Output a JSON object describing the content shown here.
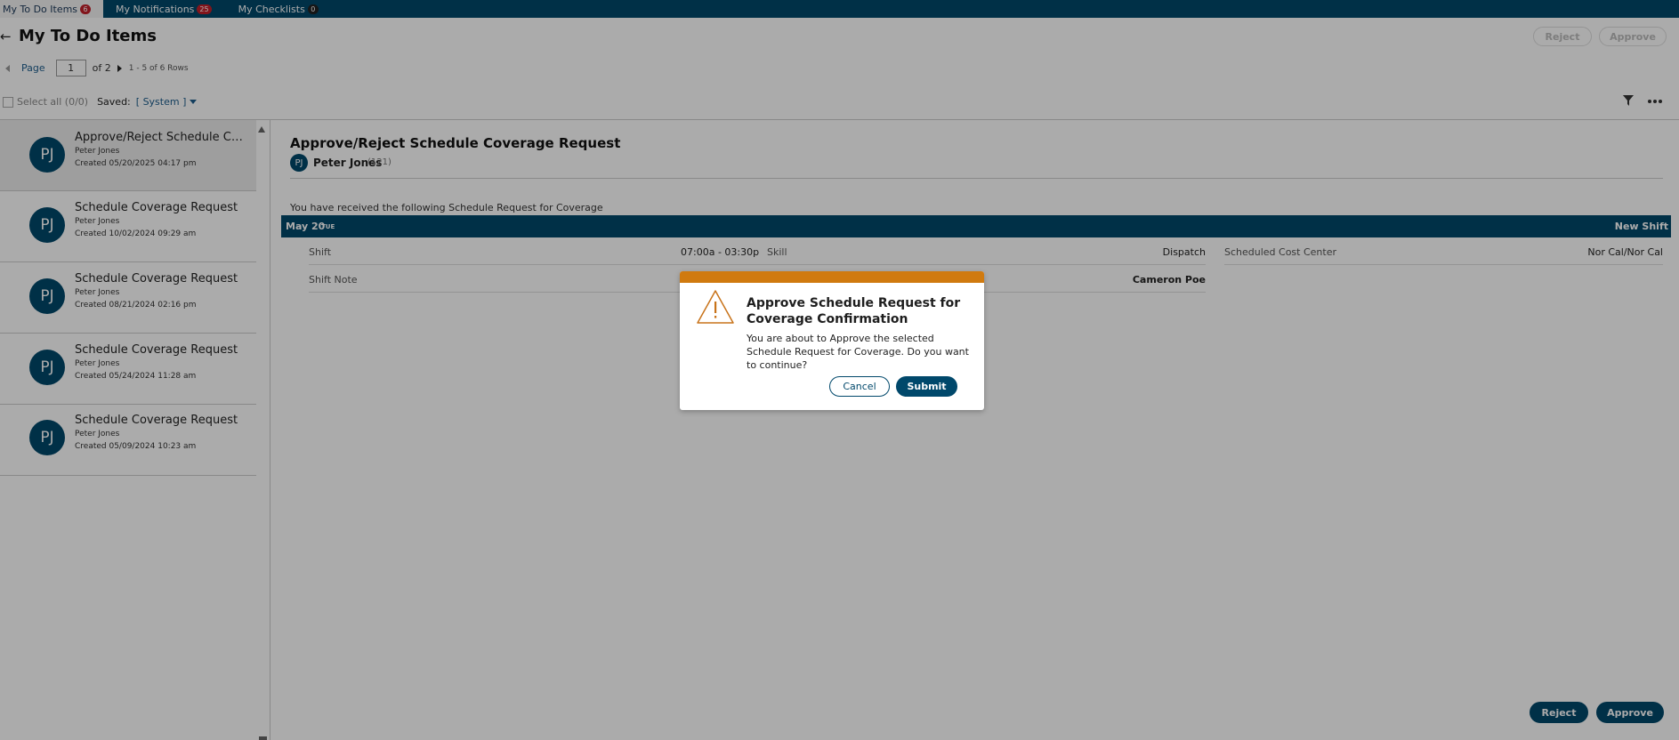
{
  "tabs": [
    {
      "label": "My To Do Items",
      "count": "6",
      "badge_color": "#c2202a"
    },
    {
      "label": "My Notifications",
      "count": "25",
      "badge_color": "#c2202a"
    },
    {
      "label": "My Checklists",
      "count": "0",
      "badge_color": "#222222"
    }
  ],
  "header": {
    "back_icon": "arrow-left-icon",
    "title": "My To Do Items",
    "reject_label": "Reject",
    "approve_label": "Approve"
  },
  "pager": {
    "page_label": "Page",
    "page_value": "1",
    "of_label": "of 2",
    "rows_label": "1 - 5 of 6 Rows"
  },
  "toolbar": {
    "select_all_label": "Select all (0/0)",
    "saved_label": "Saved:",
    "saved_value": "[ System ]",
    "filter_icon": "filter-icon",
    "more_icon": "more-icon"
  },
  "list": [
    {
      "initials": "PJ",
      "title": "Approve/Reject Schedule Cover...",
      "person": "Peter Jones",
      "created": "Created 05/20/2025 04:17 pm"
    },
    {
      "initials": "PJ",
      "title": "Schedule Coverage Request",
      "person": "Peter Jones",
      "created": "Created 10/02/2024 09:29 am"
    },
    {
      "initials": "PJ",
      "title": "Schedule Coverage Request",
      "person": "Peter Jones",
      "created": "Created 08/21/2024 02:16 pm"
    },
    {
      "initials": "PJ",
      "title": "Schedule Coverage Request",
      "person": "Peter Jones",
      "created": "Created 05/24/2024 11:28 am"
    },
    {
      "initials": "PJ",
      "title": "Schedule Coverage Request",
      "person": "Peter Jones",
      "created": "Created 05/09/2024 10:23 am"
    }
  ],
  "detail": {
    "title": "Approve/Reject Schedule Coverage Request",
    "initials": "PJ",
    "person": "Peter Jones",
    "person_id": "(121)",
    "message": "You have received the following Schedule Request for Coverage",
    "date": "May 20",
    "weekday": "TUE",
    "shift_type": "New Shift",
    "shift_label": "Shift",
    "shift_value": "07:00a - 03:30p",
    "skill_label": "Skill",
    "skill_value": "Dispatch",
    "cost_center_label": "Scheduled Cost Center",
    "cost_center_value": "Nor Cal/Nor Cal",
    "shift_note_label": "Shift Note",
    "assignee_value": "Cameron Poe",
    "reject_label": "Reject",
    "approve_label": "Approve"
  },
  "modal": {
    "title": "Approve Schedule Request for Coverage Confirmation",
    "body": "You are about to Approve the selected Schedule Request for Coverage. Do you want to continue?",
    "cancel_label": "Cancel",
    "submit_label": "Submit",
    "icon": "warning-icon",
    "accent_color": "#d07a0f"
  },
  "colors": {
    "brand": "#00486b",
    "link": "#1d5d8c"
  }
}
